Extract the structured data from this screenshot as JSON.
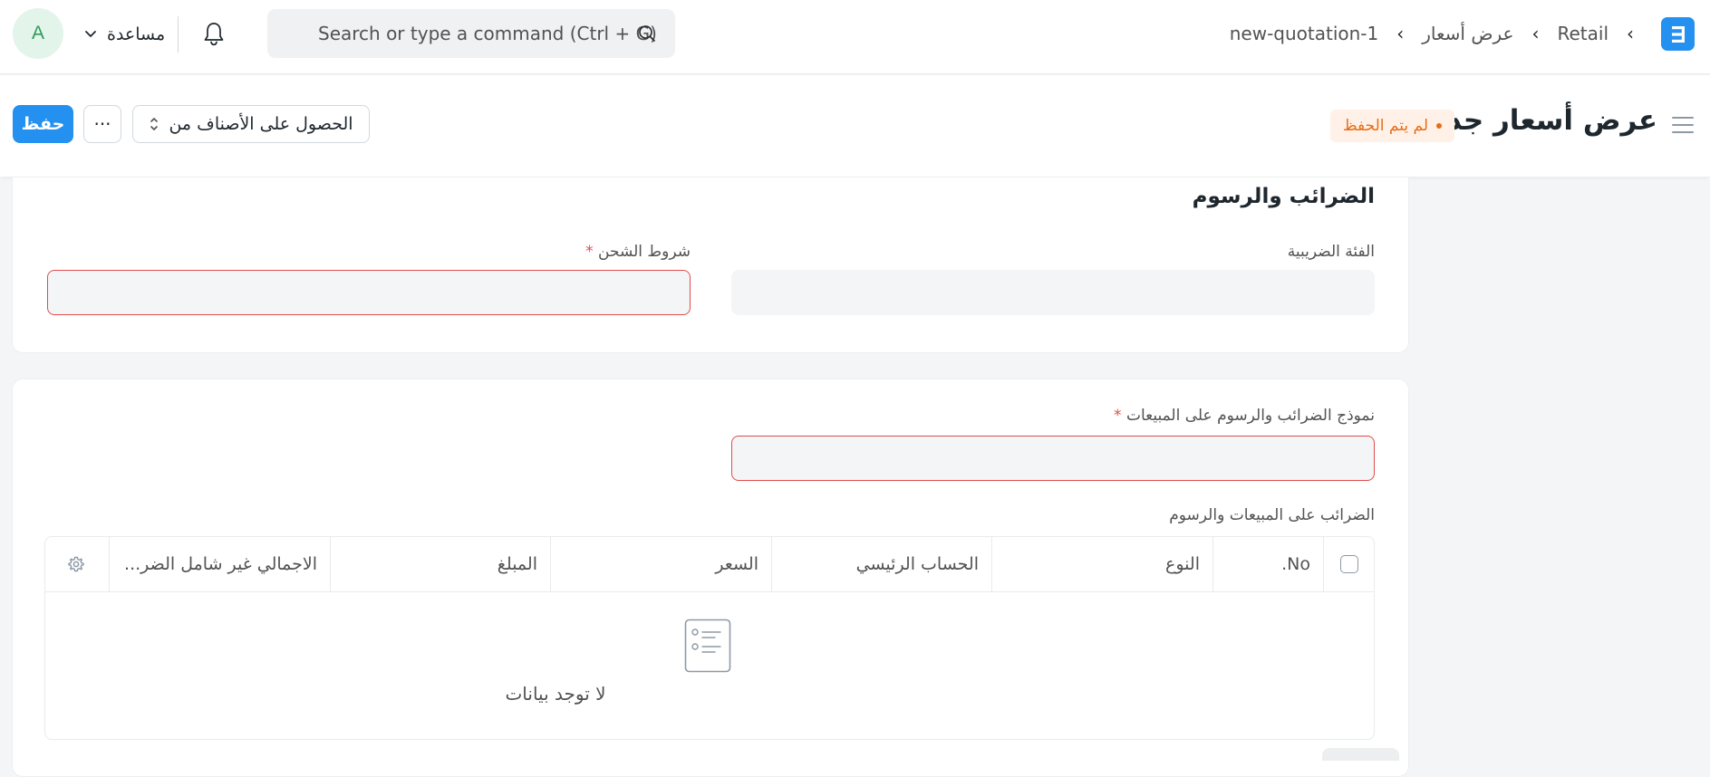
{
  "navbar": {
    "breadcrumbs": [
      "Retail",
      "عرض أسعار",
      "new-quotation-1"
    ],
    "search_placeholder": "Search or type a command (Ctrl + G)",
    "help_label": "مساعدة",
    "avatar_initial": "A"
  },
  "page": {
    "title": "عرض أسعار جديد",
    "status_badge": "لم يتم الحفظ",
    "get_items_label": "الحصول على الأصناف من",
    "more_label": "···",
    "save_label": "حفظ"
  },
  "taxes_section": {
    "title": "الضرائب والرسوم",
    "tax_category_label": "الفئة الضريبية",
    "shipping_rule_label": "شروط الشحن",
    "required_mark": "*"
  },
  "taxes_template_section": {
    "template_label": "نموذج الضرائب والرسوم على المبيعات",
    "required_mark": "*",
    "table_label": "الضرائب على المبيعات والرسوم",
    "table_columns": [
      "No.",
      "النوع",
      "الحساب الرئيسي",
      "السعر",
      "المبلغ",
      "الاجمالي غير شامل الضر..."
    ],
    "empty_text": "لا توجد بيانات"
  },
  "colors": {
    "primary": "#2490ef",
    "badge_bg": "#fff1e7",
    "badge_text": "#e86c13",
    "error_border": "#e24c4c",
    "avatar_bg": "#e3f4ea",
    "avatar_text": "#2f9b58"
  }
}
